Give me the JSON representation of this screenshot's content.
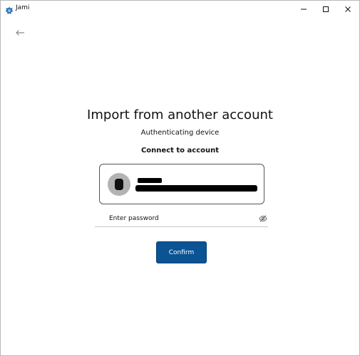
{
  "window": {
    "title": "Jami",
    "icons": {
      "app": "jami-logo-icon",
      "minimize": "minimize-icon",
      "maximize": "maximize-icon",
      "close": "close-icon"
    }
  },
  "navigation": {
    "back_icon": "arrow-left-icon"
  },
  "page": {
    "title": "Import from another account",
    "subtitle": "Authenticating device",
    "section_label": "Connect to account"
  },
  "account": {
    "name_redacted": true,
    "id_redacted": true,
    "avatar_color": "#b3b3b3"
  },
  "password": {
    "placeholder": "Enter password",
    "value": "",
    "toggle_icon": "eye-off-icon"
  },
  "actions": {
    "confirm_label": "Confirm"
  },
  "colors": {
    "accent": "#0a5394",
    "card_border": "#555555",
    "divider": "#c9c9c9"
  }
}
